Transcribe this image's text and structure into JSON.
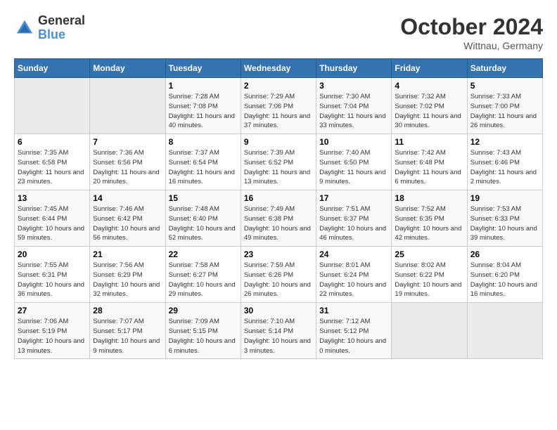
{
  "header": {
    "logo_line1": "General",
    "logo_line2": "Blue",
    "month_title": "October 2024",
    "subtitle": "Wittnau, Germany"
  },
  "days_of_week": [
    "Sunday",
    "Monday",
    "Tuesday",
    "Wednesday",
    "Thursday",
    "Friday",
    "Saturday"
  ],
  "weeks": [
    [
      {
        "day": "",
        "info": ""
      },
      {
        "day": "",
        "info": ""
      },
      {
        "day": "1",
        "info": "Sunrise: 7:28 AM\nSunset: 7:08 PM\nDaylight: 11 hours\nand 40 minutes."
      },
      {
        "day": "2",
        "info": "Sunrise: 7:29 AM\nSunset: 7:06 PM\nDaylight: 11 hours\nand 37 minutes."
      },
      {
        "day": "3",
        "info": "Sunrise: 7:30 AM\nSunset: 7:04 PM\nDaylight: 11 hours\nand 33 minutes."
      },
      {
        "day": "4",
        "info": "Sunrise: 7:32 AM\nSunset: 7:02 PM\nDaylight: 11 hours\nand 30 minutes."
      },
      {
        "day": "5",
        "info": "Sunrise: 7:33 AM\nSunset: 7:00 PM\nDaylight: 11 hours\nand 26 minutes."
      }
    ],
    [
      {
        "day": "6",
        "info": "Sunrise: 7:35 AM\nSunset: 6:58 PM\nDaylight: 11 hours\nand 23 minutes."
      },
      {
        "day": "7",
        "info": "Sunrise: 7:36 AM\nSunset: 6:56 PM\nDaylight: 11 hours\nand 20 minutes."
      },
      {
        "day": "8",
        "info": "Sunrise: 7:37 AM\nSunset: 6:54 PM\nDaylight: 11 hours\nand 16 minutes."
      },
      {
        "day": "9",
        "info": "Sunrise: 7:39 AM\nSunset: 6:52 PM\nDaylight: 11 hours\nand 13 minutes."
      },
      {
        "day": "10",
        "info": "Sunrise: 7:40 AM\nSunset: 6:50 PM\nDaylight: 11 hours\nand 9 minutes."
      },
      {
        "day": "11",
        "info": "Sunrise: 7:42 AM\nSunset: 6:48 PM\nDaylight: 11 hours\nand 6 minutes."
      },
      {
        "day": "12",
        "info": "Sunrise: 7:43 AM\nSunset: 6:46 PM\nDaylight: 11 hours\nand 2 minutes."
      }
    ],
    [
      {
        "day": "13",
        "info": "Sunrise: 7:45 AM\nSunset: 6:44 PM\nDaylight: 10 hours\nand 59 minutes."
      },
      {
        "day": "14",
        "info": "Sunrise: 7:46 AM\nSunset: 6:42 PM\nDaylight: 10 hours\nand 56 minutes."
      },
      {
        "day": "15",
        "info": "Sunrise: 7:48 AM\nSunset: 6:40 PM\nDaylight: 10 hours\nand 52 minutes."
      },
      {
        "day": "16",
        "info": "Sunrise: 7:49 AM\nSunset: 6:38 PM\nDaylight: 10 hours\nand 49 minutes."
      },
      {
        "day": "17",
        "info": "Sunrise: 7:51 AM\nSunset: 6:37 PM\nDaylight: 10 hours\nand 46 minutes."
      },
      {
        "day": "18",
        "info": "Sunrise: 7:52 AM\nSunset: 6:35 PM\nDaylight: 10 hours\nand 42 minutes."
      },
      {
        "day": "19",
        "info": "Sunrise: 7:53 AM\nSunset: 6:33 PM\nDaylight: 10 hours\nand 39 minutes."
      }
    ],
    [
      {
        "day": "20",
        "info": "Sunrise: 7:55 AM\nSunset: 6:31 PM\nDaylight: 10 hours\nand 36 minutes."
      },
      {
        "day": "21",
        "info": "Sunrise: 7:56 AM\nSunset: 6:29 PM\nDaylight: 10 hours\nand 32 minutes."
      },
      {
        "day": "22",
        "info": "Sunrise: 7:58 AM\nSunset: 6:27 PM\nDaylight: 10 hours\nand 29 minutes."
      },
      {
        "day": "23",
        "info": "Sunrise: 7:59 AM\nSunset: 6:26 PM\nDaylight: 10 hours\nand 26 minutes."
      },
      {
        "day": "24",
        "info": "Sunrise: 8:01 AM\nSunset: 6:24 PM\nDaylight: 10 hours\nand 22 minutes."
      },
      {
        "day": "25",
        "info": "Sunrise: 8:02 AM\nSunset: 6:22 PM\nDaylight: 10 hours\nand 19 minutes."
      },
      {
        "day": "26",
        "info": "Sunrise: 8:04 AM\nSunset: 6:20 PM\nDaylight: 10 hours\nand 16 minutes."
      }
    ],
    [
      {
        "day": "27",
        "info": "Sunrise: 7:06 AM\nSunset: 5:19 PM\nDaylight: 10 hours\nand 13 minutes."
      },
      {
        "day": "28",
        "info": "Sunrise: 7:07 AM\nSunset: 5:17 PM\nDaylight: 10 hours\nand 9 minutes."
      },
      {
        "day": "29",
        "info": "Sunrise: 7:09 AM\nSunset: 5:15 PM\nDaylight: 10 hours\nand 6 minutes."
      },
      {
        "day": "30",
        "info": "Sunrise: 7:10 AM\nSunset: 5:14 PM\nDaylight: 10 hours\nand 3 minutes."
      },
      {
        "day": "31",
        "info": "Sunrise: 7:12 AM\nSunset: 5:12 PM\nDaylight: 10 hours\nand 0 minutes."
      },
      {
        "day": "",
        "info": ""
      },
      {
        "day": "",
        "info": ""
      }
    ]
  ]
}
